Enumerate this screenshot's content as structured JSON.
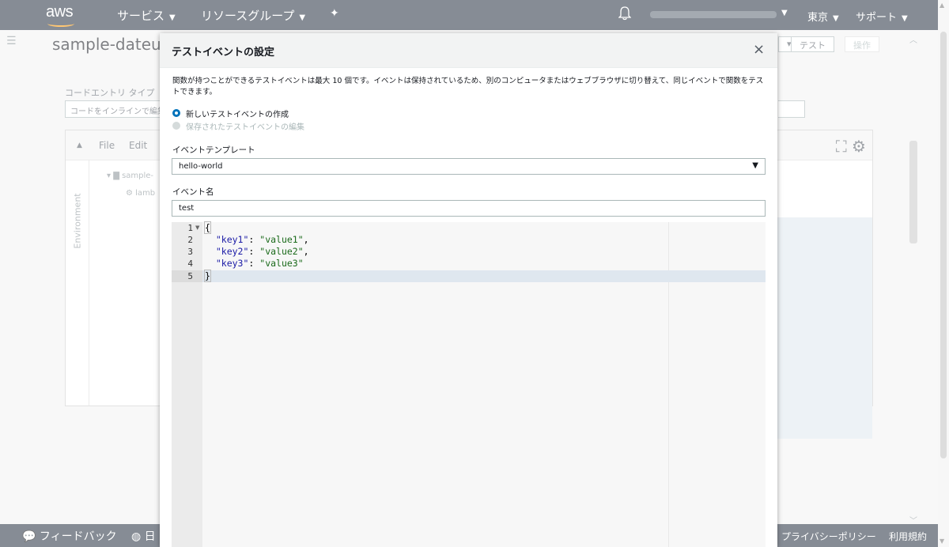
{
  "topnav": {
    "logo": "aws",
    "services": "サービス",
    "resource_groups": "リソースグループ",
    "region": "東京",
    "support": "サポート"
  },
  "background": {
    "function_title": "sample-dateuti",
    "code_entry_label": "コードエントリ タイプ",
    "code_entry_value": "コードをインラインで編集",
    "test_button": "テスト",
    "action_button": "操作",
    "editor_menu_file": "File",
    "editor_menu_edit": "Edit",
    "environment_tab": "Environment",
    "tree_folder": "sample-",
    "tree_file": "lamb"
  },
  "footer": {
    "feedback": "フィードバック",
    "language": "日",
    "privacy": "プライバシーポリシー",
    "terms": "利用規約"
  },
  "modal": {
    "title": "テストイベントの設定",
    "close": "×",
    "description": "関数が持つことができるテストイベントは最大 10 個です。イベントは保持されているため、別のコンピュータまたはウェブブラウザに切り替えて、同じイベントで関数をテストできます。",
    "radio_new": "新しいテストイベントの作成",
    "radio_edit": "保存されたテストイベントの編集",
    "template_label": "イベントテンプレート",
    "template_value": "hello-world",
    "event_name_label": "イベント名",
    "event_name_value": "test",
    "code": {
      "line_numbers": [
        "1",
        "2",
        "3",
        "4",
        "5"
      ],
      "open_brace": "{",
      "close_brace": "}",
      "entries": [
        {
          "key": "\"key1\"",
          "value": "\"value1\"",
          "sep": ","
        },
        {
          "key": "\"key2\"",
          "value": "\"value2\"",
          "sep": ","
        },
        {
          "key": "\"key3\"",
          "value": "\"value3\"",
          "sep": ""
        }
      ]
    }
  }
}
